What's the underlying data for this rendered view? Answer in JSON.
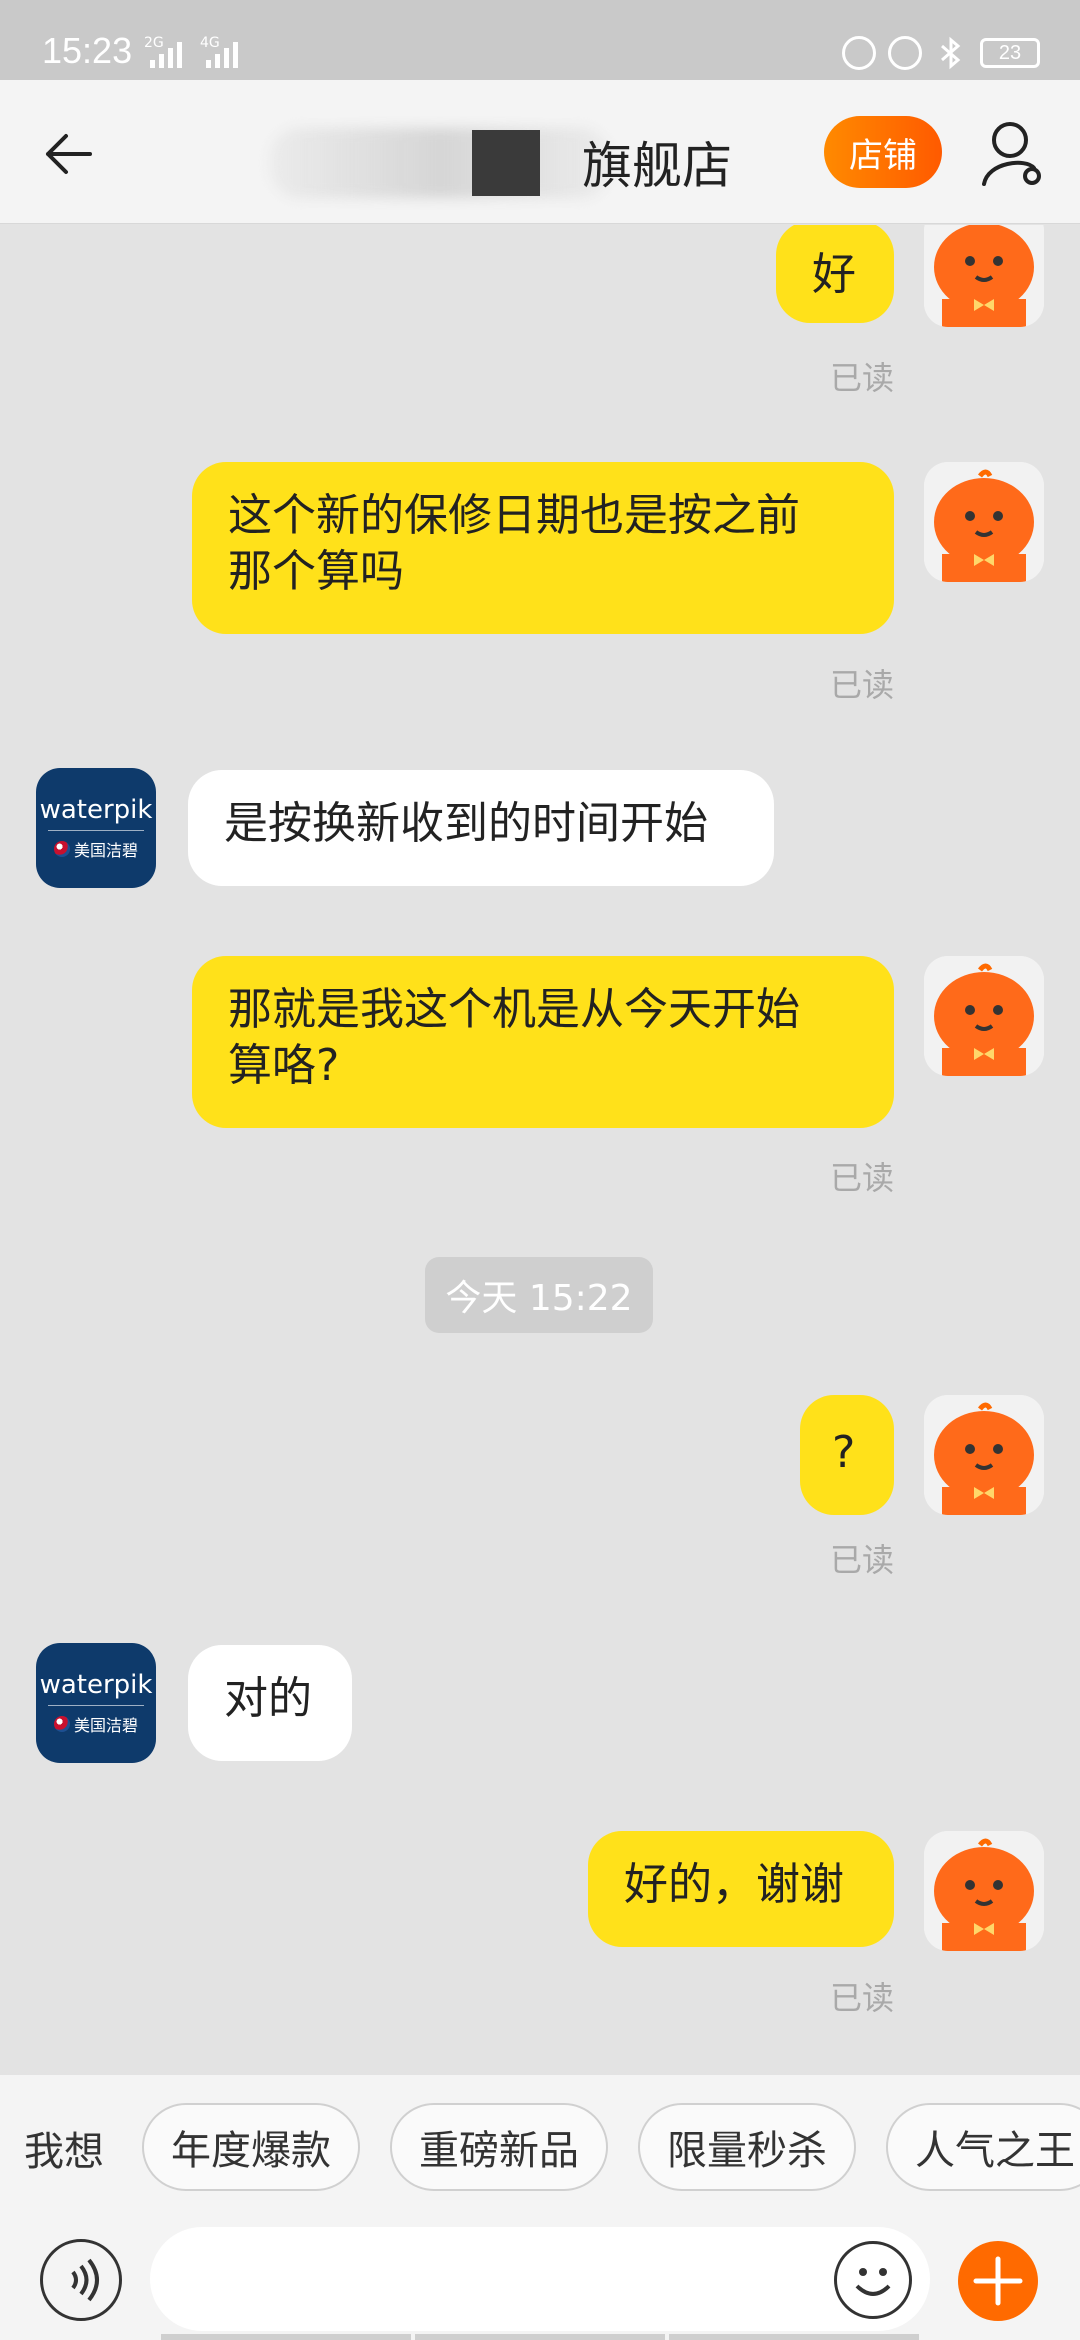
{
  "status_bar": {
    "time": "15:23",
    "net1": "2G",
    "net2": "4G",
    "battery": "23"
  },
  "header": {
    "title_suffix": "旗舰店",
    "shop_button": "店铺",
    "accent_color": "#ff6a00"
  },
  "messages": [
    {
      "side": "me",
      "text": "好",
      "read": "已读"
    },
    {
      "side": "me",
      "text_line1": "这个新的保修日期也是按之前",
      "text_line2": "那个算吗",
      "read": "已读"
    },
    {
      "side": "them",
      "text": "是按换新收到的时间开始"
    },
    {
      "side": "me",
      "text_line1": "那就是我这个机是从今天开始",
      "text_line2": "算咯?",
      "read": "已读"
    },
    {
      "side": "me",
      "text": "?",
      "read": "已读"
    },
    {
      "side": "them",
      "text": "对的"
    },
    {
      "side": "me",
      "text": "好的，谢谢",
      "read": "已读"
    }
  ],
  "timestamp": "今天  15:22",
  "shop_avatar": {
    "brand": "waterpik",
    "sub": "美国洁碧"
  },
  "suggestions": {
    "label": "我想",
    "chips": [
      "年度爆款",
      "重磅新品",
      "限量秒杀",
      "人气之王"
    ]
  },
  "input": {
    "placeholder": ""
  }
}
